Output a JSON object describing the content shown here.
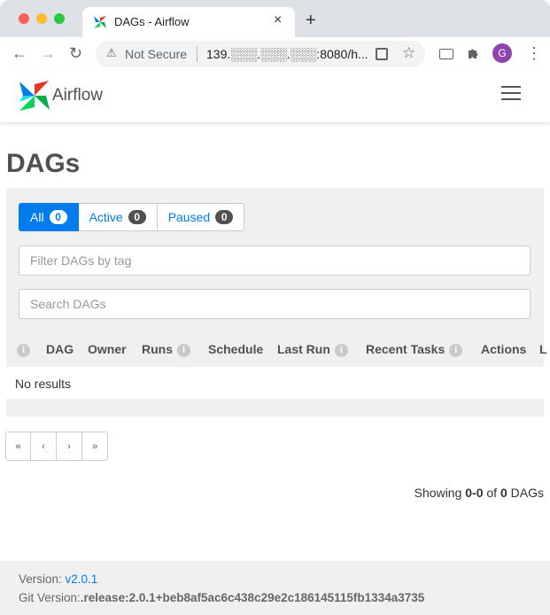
{
  "browser": {
    "tab_title": "DAGs - Airflow",
    "tab_close": "×",
    "new_tab": "+",
    "back": "←",
    "forward": "→",
    "reload": "↻",
    "security_warning": "⚠",
    "security_text": "Not Secure",
    "url": "139.░░░.░░░.░░░:8080/h...",
    "star": "☆",
    "profile_initial": "G",
    "kebab": "⋮",
    "colors": {
      "chrome": "#dee1e6",
      "profile": "#8e44ad"
    }
  },
  "navbar": {
    "brand": "Airflow"
  },
  "page": {
    "title": "DAGs"
  },
  "filters": {
    "all_label": "All",
    "all_count": "0",
    "active_label": "Active",
    "active_count": "0",
    "paused_label": "Paused",
    "paused_count": "0",
    "tag_placeholder": "Filter DAGs by tag",
    "search_placeholder": "Search DAGs"
  },
  "table": {
    "info_glyph": "i",
    "columns": {
      "dag": "DAG",
      "owner": "Owner",
      "runs": "Runs",
      "schedule": "Schedule",
      "last_run": "Last Run",
      "recent_tasks": "Recent Tasks",
      "actions": "Actions",
      "links": "L"
    },
    "empty_text": "No results"
  },
  "pagination": {
    "first": "«",
    "prev": "‹",
    "next": "›",
    "last": "»",
    "showing_prefix": "Showing ",
    "range": "0-0",
    "of": " of ",
    "total": "0",
    "suffix": " DAGs"
  },
  "footer": {
    "version_label": "Version: ",
    "version": "v2.0.1",
    "git_label": "Git Version:",
    "git_version": ".release:2.0.1+beb8af5ac6c438c29e2c186145115fb1334a3735"
  },
  "colors": {
    "accent": "#017cee",
    "panel": "#f0f0f0",
    "text": "#51504f"
  }
}
